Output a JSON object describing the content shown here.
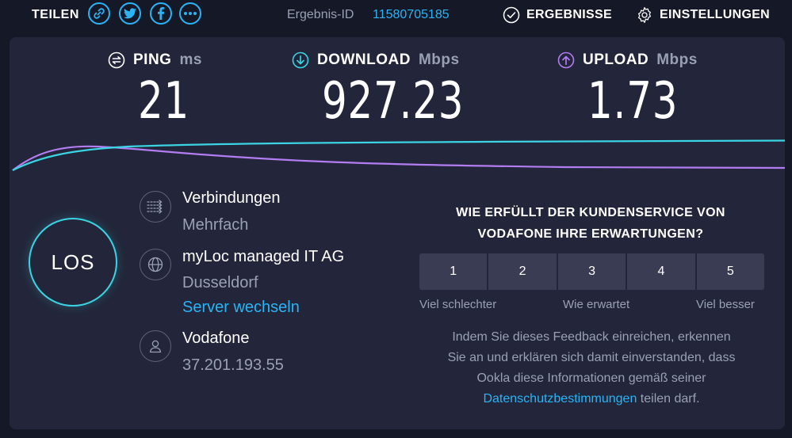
{
  "topbar": {
    "share_label": "TEILEN",
    "share_buttons": [
      "link-icon",
      "twitter-icon",
      "facebook-icon",
      "more-icon"
    ],
    "result_label": "Ergebnis-ID",
    "result_id": "11580705185",
    "results_label": "ERGEBNISSE",
    "settings_label": "EINSTELLUNGEN"
  },
  "metrics": {
    "ping": {
      "label": "PING",
      "unit": "ms",
      "value": "21",
      "icon": "ping-icon"
    },
    "download": {
      "label": "DOWNLOAD",
      "unit": "Mbps",
      "value": "927.23",
      "icon": "download-icon"
    },
    "upload": {
      "label": "UPLOAD",
      "unit": "Mbps",
      "value": "1.73",
      "icon": "upload-icon"
    }
  },
  "colors": {
    "accent": "#2ab4f5",
    "download": "#3ad4e3",
    "upload": "#b37df2",
    "panel": "#23263a",
    "background": "#151827"
  },
  "go_button": {
    "label": "LOS"
  },
  "connection": {
    "label": "Verbindungen",
    "value": "Mehrfach"
  },
  "server": {
    "name": "myLoc managed IT AG",
    "city": "Dusseldorf",
    "change_link": "Server wechseln"
  },
  "provider": {
    "name": "Vodafone",
    "ip": "37.201.193.55"
  },
  "survey": {
    "question_line1": "WIE ERFÜLLT DER KUNDENSERVICE VON",
    "question_line2": "VODAFONE IHRE ERWARTUNGEN?",
    "ratings": [
      "1",
      "2",
      "3",
      "4",
      "5"
    ],
    "scale_low": "Viel schlechter",
    "scale_mid": "Wie erwartet",
    "scale_high": "Viel besser",
    "disclaimer_line1": "Indem Sie dieses Feedback einreichen, erkennen",
    "disclaimer_line2": "Sie an und erklären sich damit einverstanden, dass",
    "disclaimer_line3": "Ookla diese Informationen gemäß seiner",
    "privacy_link": "Datenschutzbestimmungen",
    "disclaimer_end": " teilen darf."
  }
}
